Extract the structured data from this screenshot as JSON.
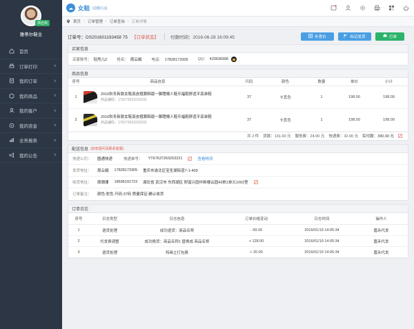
{
  "sidebar": {
    "badge": "供应商",
    "shop_name": "雅蒂尔鞋业",
    "items": [
      {
        "label": "首页",
        "icon": "home-icon",
        "arrow": ""
      },
      {
        "label": "订单打印",
        "icon": "print-icon",
        "arrow": "∨"
      },
      {
        "label": "我的订单",
        "icon": "orders-icon",
        "arrow": "∨"
      },
      {
        "label": "我的商品",
        "icon": "goods-icon",
        "arrow": "∨"
      },
      {
        "label": "我的客户",
        "icon": "customers-icon",
        "arrow": "∨"
      },
      {
        "label": "我的资金",
        "icon": "money-icon",
        "arrow": "∨"
      },
      {
        "label": "业务报表",
        "icon": "report-icon",
        "arrow": "∨"
      },
      {
        "label": "我的公告",
        "icon": "notice-icon",
        "arrow": "∨"
      }
    ]
  },
  "topbar": {
    "brand": "女鞋",
    "switch_label": "切换行业",
    "icons": [
      "message-icon",
      "user-icon",
      "settings-icon",
      "print-icon",
      "qrcode-icon",
      "power-icon"
    ]
  },
  "breadcrumb": [
    "首页",
    "订单管理",
    "订单查询",
    "订单详情"
  ],
  "order": {
    "number": "订单号：DS201601193458 75",
    "status": "【订单状态】",
    "time": "付款时间：2016-06-28 16:09:45",
    "btn_price": "补差价",
    "btn_mark": "标记发货",
    "btn_print": "打单"
  },
  "buyer": {
    "title": "买家信息",
    "account_label": "买家账号：",
    "account": "轻然儿Z",
    "name_label": "姓名：",
    "name": "周云娟",
    "phone_label": "电话：",
    "phone": "17828173305",
    "qq_label": "QQ：",
    "qq": "420636996"
  },
  "goods": {
    "title": "商品信息",
    "headers": [
      "序号",
      "商品信息",
      "尺码",
      "颜色",
      "数量",
      "单价",
      "小计"
    ],
    "rows": [
      {
        "idx": "1",
        "name": "2016秋冬新款女鞋真皮粗跟韩版一脚蹬懒人鞋乐福鞋舒适平底单鞋",
        "code": "商品编码：176273023232232",
        "size": "37",
        "color": "卡其色",
        "qty": "1",
        "price": "198.00",
        "subtotal": "198.00"
      },
      {
        "idx": "2",
        "name": "2016秋冬新款女鞋真皮粗跟韩版一脚蹬懒人鞋乐福鞋舒适平底单鞋",
        "code": "商品编码：176273023232232",
        "size": "37",
        "color": "卡其色",
        "qty": "1",
        "price": "198.00",
        "subtotal": "198.00"
      }
    ],
    "summary": {
      "count": "共 2 件",
      "goods_amount": "货款：131.00 元",
      "service_fee": "服务费：24.00 元",
      "shipping_fee": "快递费：32.00 元",
      "paid": "实付款：390.00 元"
    }
  },
  "shipping": {
    "title": "配送信息",
    "note": "(如有疑问请联系客服)",
    "express_label": "快递公司：",
    "express": "圆通快递",
    "tracking_label": "快递单号：",
    "tracking": "YT67637263263221",
    "track_link": "查看物流",
    "sender_label": "发货地址：",
    "sender_name": "周云娟",
    "sender_phone": "17828173305",
    "sender_addr": "重庆市渝北区宝圣湖街道7-1-409",
    "receiver_label": "收货地址：",
    "receiver_name": "周珊珊",
    "receiver_phone": "18696191723",
    "receiver_addr": "湖北省 武汉市 东西湖区 财富兴园中新楼云园42栋1单元1002室",
    "remark_label": "订单备注：",
    "remark": "颜色:驼色  尺码:37码  质量保证:确认收货"
  },
  "log": {
    "title": "订单日志",
    "headers": [
      "序号",
      "日志类型",
      "日志信息",
      "订单价格变动",
      "日志时间",
      "操作人"
    ],
    "rows": [
      {
        "idx": "1",
        "type": "退货处理",
        "info": "成功退货：商品名称",
        "change": "- 99.00",
        "time": "2016/01/19 14:05:34",
        "operator": "嘉禾代发"
      },
      {
        "idx": "2",
        "type": "代发费调整",
        "info": "成功换货：商品名称1 替换成 商品名称",
        "change": "+ 128.00",
        "time": "2016/01/19 14:05:34",
        "operator": "嘉禾代发"
      },
      {
        "idx": "3",
        "type": "退货处理",
        "info": "特具立打包费",
        "change": "+ 20.00",
        "time": "2016/01/19 14:05:34",
        "operator": "嘉禾代发"
      }
    ]
  }
}
